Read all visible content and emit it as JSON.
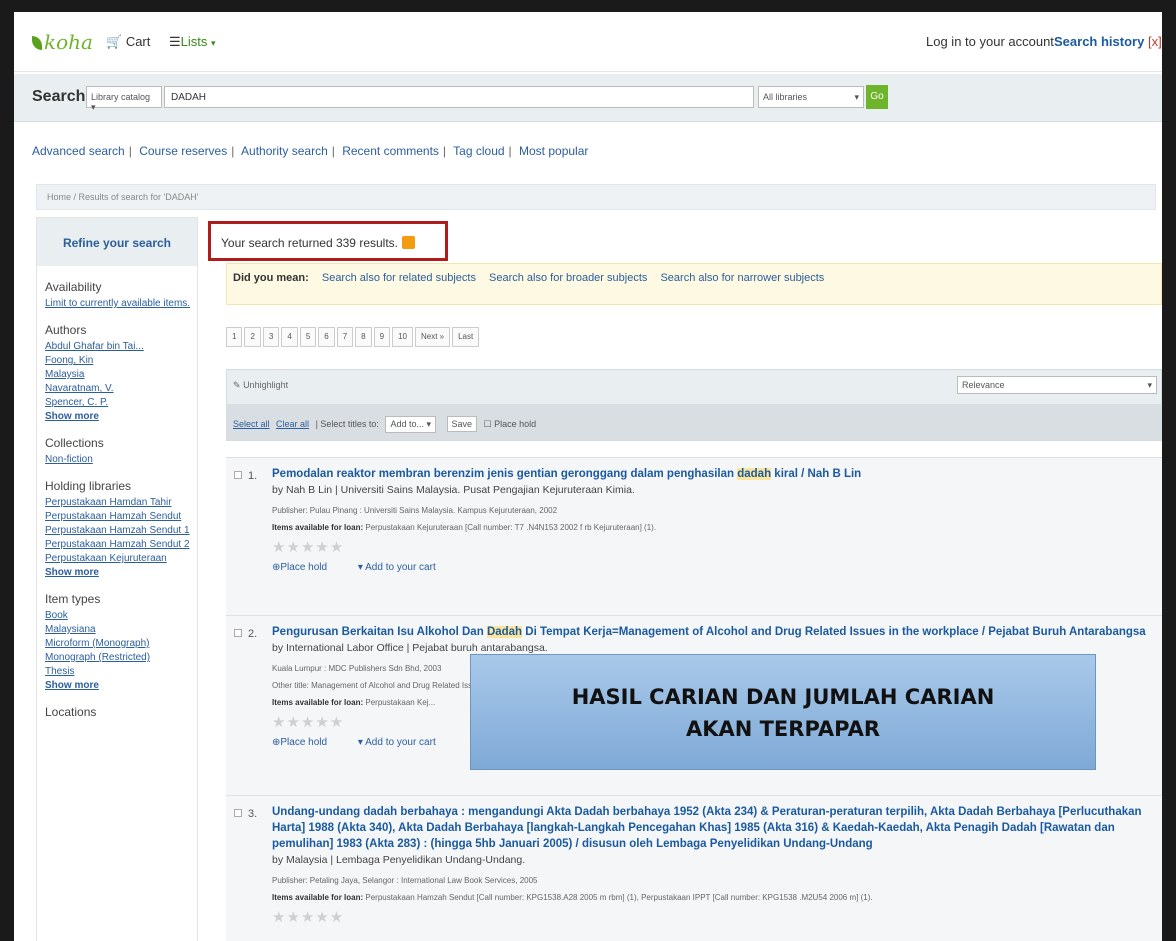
{
  "topnav": {
    "logo": "koha",
    "cart": "Cart",
    "lists": "Lists",
    "login": "Log in to your account",
    "search_history": "Search history",
    "history_close": "[x]"
  },
  "searchbar": {
    "label": "Search",
    "catalog_select": "Library catalog",
    "query": "DADAH",
    "libraries_select": "All libraries",
    "go": "Go"
  },
  "links": [
    "Advanced search",
    "Course reserves",
    "Authority search",
    "Recent comments",
    "Tag cloud",
    "Most popular"
  ],
  "breadcrumb": "Home / Results of search for 'DADAH'",
  "sidebar": {
    "refine": "Refine your search",
    "availability": "Availability",
    "availability_link": "Limit to currently available items.",
    "authors": "Authors",
    "author_items": [
      "Abdul Ghafar bin Tai...",
      "Foong, Kin",
      "Malaysia",
      "Navaratnam, V.",
      "Spencer, C. P."
    ],
    "collections": "Collections",
    "collection_items": [
      "Non-fiction"
    ],
    "holding": "Holding libraries",
    "holding_items": [
      "Perpustakaan Hamdan Tahir",
      "Perpustakaan Hamzah Sendut",
      "Perpustakaan Hamzah Sendut 1",
      "Perpustakaan Hamzah Sendut 2",
      "Perpustakaan Kejuruteraan"
    ],
    "item_types": "Item types",
    "type_items": [
      "Book",
      "Malaysiana",
      "Microform (Monograph)",
      "Monograph (Restricted)",
      "Thesis"
    ],
    "show_more": "Show more",
    "locations": "Locations"
  },
  "results": {
    "count_text": "Your search returned 339 results.",
    "did_you_mean": "Did you mean:",
    "suggestions": [
      "Search also for related subjects",
      "Search also for broader subjects",
      "Search also for narrower subjects"
    ],
    "pages": [
      "1",
      "2",
      "3",
      "4",
      "5",
      "6",
      "7",
      "8",
      "9",
      "10",
      "Next »",
      "Last"
    ],
    "unhighlight": "Unhighlight",
    "sort": "Relevance",
    "select_all": "Select all",
    "clear_all": "Clear all",
    "select_titles": "Select titles to:",
    "add_to": "Add to...",
    "save": "Save",
    "place_hold": "Place hold"
  },
  "items": [
    {
      "num": "1.",
      "title_pre": "Pemodalan reaktor membran berenzim jenis gentian geronggang dalam penghasilan ",
      "title_hl": "dadah",
      "title_post": " kiral / Nah B Lin",
      "by": "by Nah B Lin | Universiti Sains Malaysia. Pusat Pengajian Kejuruteraan Kimia.",
      "pub": "Publisher: Pulau Pinang : Universiti Sains Malaysia. Kampus Kejuruteraan, 2002",
      "avail_label": "Items available for loan:",
      "avail": " Perpustakaan Kejuruteraan [Call number: T7 .N4N153 2002 f rb Kejuruteraan] (1).",
      "place_hold": "Place hold",
      "add_cart": "Add to your cart"
    },
    {
      "num": "2.",
      "title_pre": "Pengurusan Berkaitan Isu Alkohol Dan ",
      "title_hl": "Dadah",
      "title_post": " Di Tempat Kerja=Management of Alcohol and Drug Related Issues in the workplace / Pejabat Buruh Antarabangsa",
      "by": "by International Labor Office | Pejabat buruh antarabangsa.",
      "pub": "Kuala Lumpur : MDC Publishers Sdn Bhd, 2003",
      "other": "Other title: Management of Alcohol and Drug Related Iss...",
      "avail_label": "Items available for loan:",
      "avail": " Perpustakaan Kej...",
      "place_hold": "Place hold",
      "add_cart": "Add to your cart"
    },
    {
      "num": "3.",
      "title_full": "Undang-undang dadah berbahaya : mengandungi Akta Dadah berbahaya 1952 (Akta 234) & Peraturan-peraturan terpilih, Akta Dadah Berbahaya [Perlucuthakan Harta] 1988 (Akta 340), Akta Dadah Berbahaya [langkah-Langkah Pencegahan Khas] 1985 (Akta 316) & Kaedah-Kaedah, Akta Penagih Dadah [Rawatan dan pemulihan] 1983 (Akta 283) : (hingga 5hb Januari 2005) / disusun oleh Lembaga Penyelidikan Undang-Undang",
      "by": "by Malaysia | Lembaga Penyelidikan Undang-Undang.",
      "pub": "Publisher: Petaling Jaya, Selangor : International Law Book Services, 2005",
      "avail_label": "Items available for loan:",
      "avail": " Perpustakaan Hamzah Sendut [Call number: KPG1538.A28 2005 m rbm] (1), Perpustakaan IPPT [Call number: KPG1538 .M2U54 2006 m] (1)."
    }
  ],
  "stars": "★★★★★",
  "overlay": {
    "line1": "HASIL CARIAN DAN JUMLAH CARIAN",
    "line2": "AKAN TERPAPAR"
  }
}
